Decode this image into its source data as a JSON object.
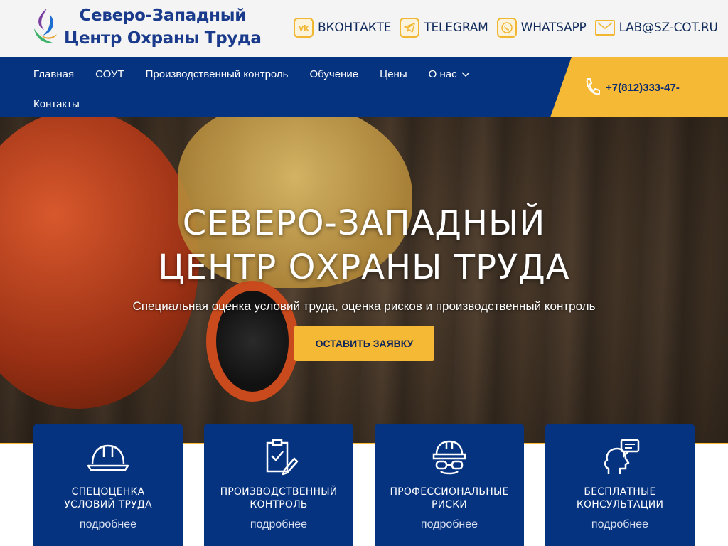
{
  "logo": {
    "line1": "Северо-Западный",
    "line2": "Центр Охраны Труда"
  },
  "contacts": [
    {
      "label": "ВКОНТАКТЕ",
      "icon": "vk-icon"
    },
    {
      "label": "TELEGRAM",
      "icon": "telegram-icon"
    },
    {
      "label": "WHATSAPP",
      "icon": "whatsapp-icon"
    },
    {
      "label": "LAB@SZ-COT.RU",
      "icon": "mail-icon"
    }
  ],
  "nav": {
    "items": [
      "Главная",
      "СОУТ",
      "Производственный контроль",
      "Обучение",
      "Цены",
      "О нас",
      "Контакты"
    ]
  },
  "phone": "+7(812)333-47-",
  "hero": {
    "title_line1": "СЕВЕРО-ЗАПАДНЫЙ",
    "title_line2": "ЦЕНТР ОХРАНЫ ТРУДА",
    "subtitle": "Специальная оценка условий труда, оценка рисков и производственный контроль",
    "button": "ОСТАВИТЬ ЗАЯВКУ"
  },
  "cards": [
    {
      "line1": "СПЕЦОЦЕНКА",
      "line2": "УСЛОВИЙ ТРУДА",
      "more": "подробнее",
      "icon": "hard-hat-icon"
    },
    {
      "line1": "ПРОИЗВОДСТВЕННЫЙ",
      "line2": "КОНТРОЛЬ",
      "more": "подробнее",
      "icon": "checklist-icon"
    },
    {
      "line1": "ПРОФЕССИОНАЛЬНЫЕ",
      "line2": "РИСКИ",
      "more": "подробнее",
      "icon": "worker-icon"
    },
    {
      "line1": "БЕСПЛАТНЫЕ",
      "line2": "КОНСУЛЬТАЦИИ",
      "more": "подробнее",
      "icon": "consultation-icon"
    }
  ],
  "colors": {
    "brand_blue": "#063380",
    "accent_yellow": "#f6b936",
    "logo_blue": "#1a3b8c"
  }
}
